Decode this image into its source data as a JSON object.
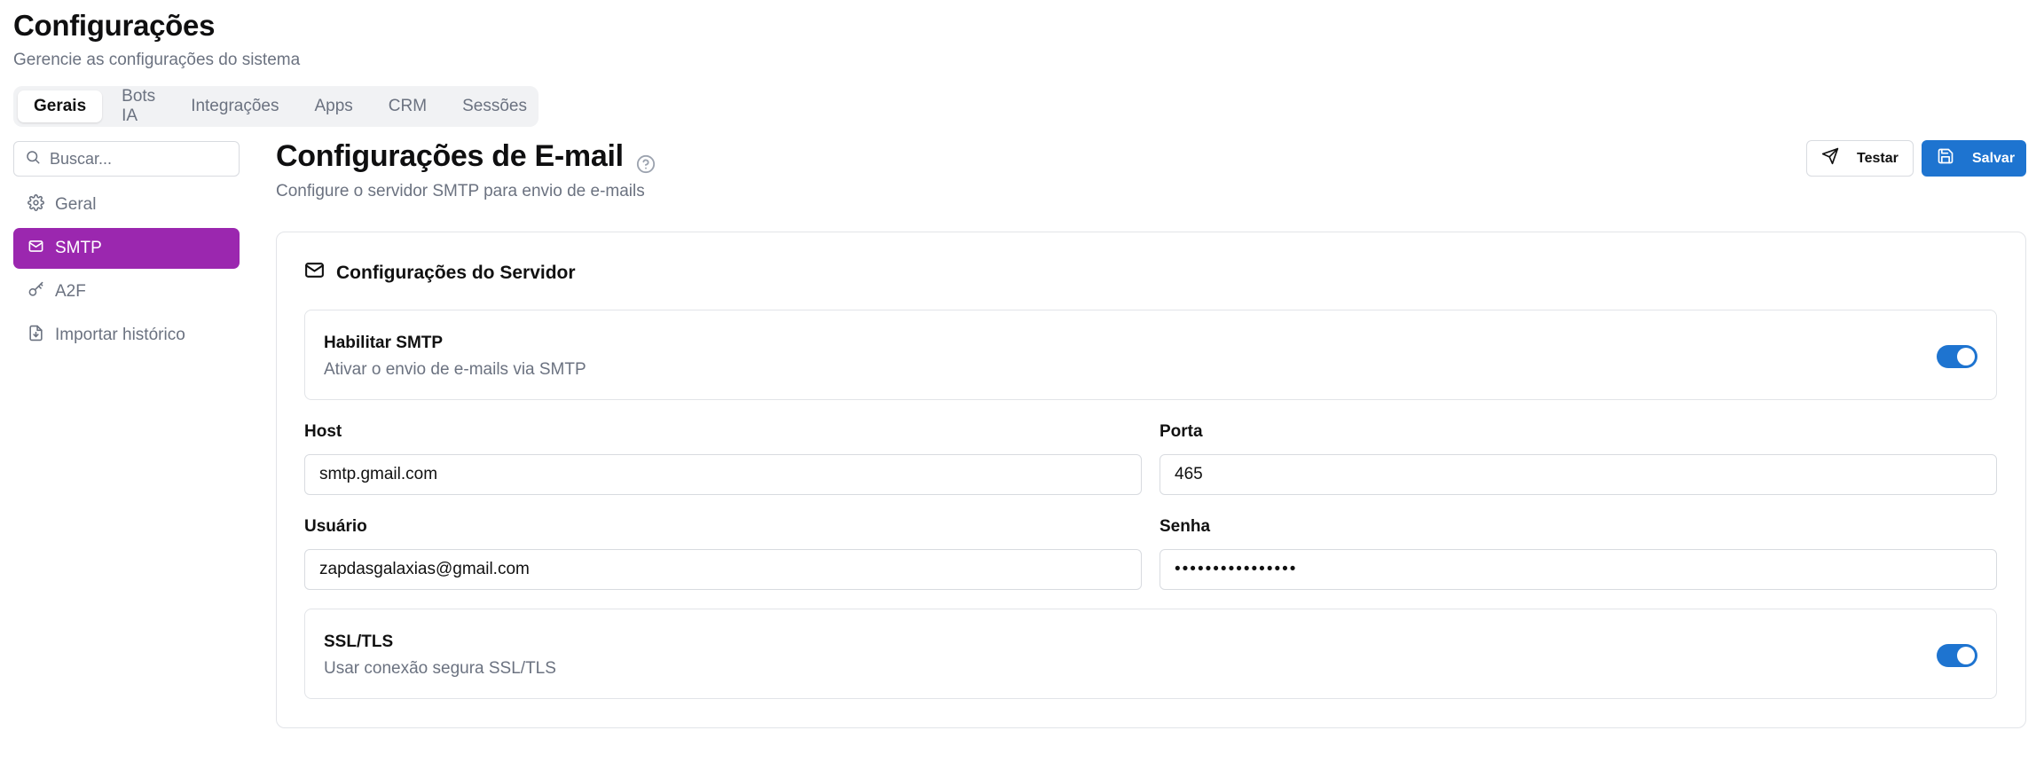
{
  "header": {
    "title": "Configurações",
    "subtitle": "Gerencie as configurações do sistema"
  },
  "tabs": [
    {
      "label": "Gerais",
      "active": true
    },
    {
      "label": "Bots IA"
    },
    {
      "label": "Integrações"
    },
    {
      "label": "Apps"
    },
    {
      "label": "CRM"
    },
    {
      "label": "Sessões"
    }
  ],
  "sidebar": {
    "search_placeholder": "Buscar...",
    "items": [
      {
        "label": "Geral",
        "icon": "gear-icon"
      },
      {
        "label": "SMTP",
        "icon": "mail-icon",
        "active": true
      },
      {
        "label": "A2F",
        "icon": "key-icon"
      },
      {
        "label": "Importar histórico",
        "icon": "file-import-icon"
      }
    ]
  },
  "section": {
    "title": "Configurações de E-mail",
    "subtitle": "Configure o servidor SMTP para envio de e-mails",
    "test_label": "Testar",
    "save_label": "Salvar"
  },
  "card": {
    "title": "Configurações do Servidor",
    "smtp_toggle": {
      "label": "Habilitar SMTP",
      "description": "Ativar o envio de e-mails via SMTP",
      "enabled": true
    },
    "host": {
      "label": "Host",
      "value": "smtp.gmail.com"
    },
    "port": {
      "label": "Porta",
      "value": "465"
    },
    "user": {
      "label": "Usuário",
      "value": "zapdasgalaxias@gmail.com"
    },
    "password": {
      "label": "Senha",
      "value": "••••••••••••••••"
    },
    "ssl_toggle": {
      "label": "SSL/TLS",
      "description": "Usar conexão segura SSL/TLS",
      "enabled": true
    }
  },
  "colors": {
    "accent_purple": "#9b27af",
    "primary_blue": "#1e74d0",
    "muted_text": "#6b7280",
    "border": "#e2e4e8"
  }
}
